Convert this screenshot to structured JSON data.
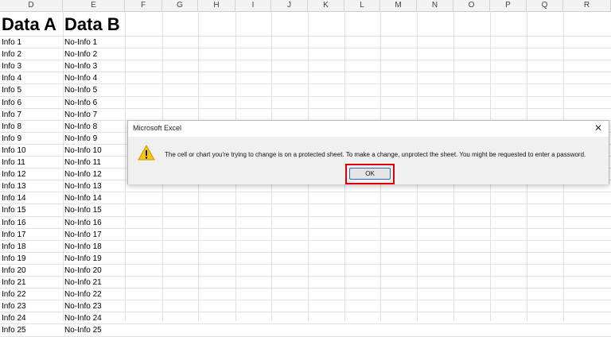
{
  "sheet": {
    "columns": [
      "D",
      "E",
      "F",
      "G",
      "H",
      "I",
      "J",
      "K",
      "L",
      "M",
      "N",
      "O",
      "P",
      "Q",
      "R"
    ],
    "header_a": "Data A",
    "header_b": "Data B",
    "col_d": [
      "Info 1",
      "Info 2",
      "Info 3",
      "Info 4",
      "Info 5",
      "Info 6",
      "Info 7",
      "Info 8",
      "Info 9",
      "Info 10",
      "Info 11",
      "Info 12",
      "Info 13",
      "Info 14",
      "Info 15",
      "Info 16",
      "Info 17",
      "Info 18",
      "Info 19",
      "Info 20",
      "Info 21",
      "Info 22",
      "Info 23",
      "Info 24",
      "Info 25"
    ],
    "col_e": [
      "No-Info 1",
      "No-Info 2",
      "No-Info 3",
      "No-Info 4",
      "No-Info 5",
      "No-Info 6",
      "No-Info 7",
      "No-Info 8",
      "No-Info 9",
      "No-Info 10",
      "No-Info 11",
      "No-Info 12",
      "No-Info 13",
      "No-Info 14",
      "No-Info 15",
      "No-Info 16",
      "No-Info 17",
      "No-Info 18",
      "No-Info 19",
      "No-Info 20",
      "No-Info 21",
      "No-Info 22",
      "No-Info 23",
      "No-Info 24",
      "No-Info 25"
    ]
  },
  "dialog": {
    "title": "Microsoft Excel",
    "close_icon": "close-icon",
    "warning_icon": "warning-icon",
    "message": "The cell or chart you're trying to change is on a protected sheet. To make a change, unprotect the sheet. You might be requested to enter a password.",
    "ok_label": "OK",
    "highlight_color": "#e00000"
  }
}
